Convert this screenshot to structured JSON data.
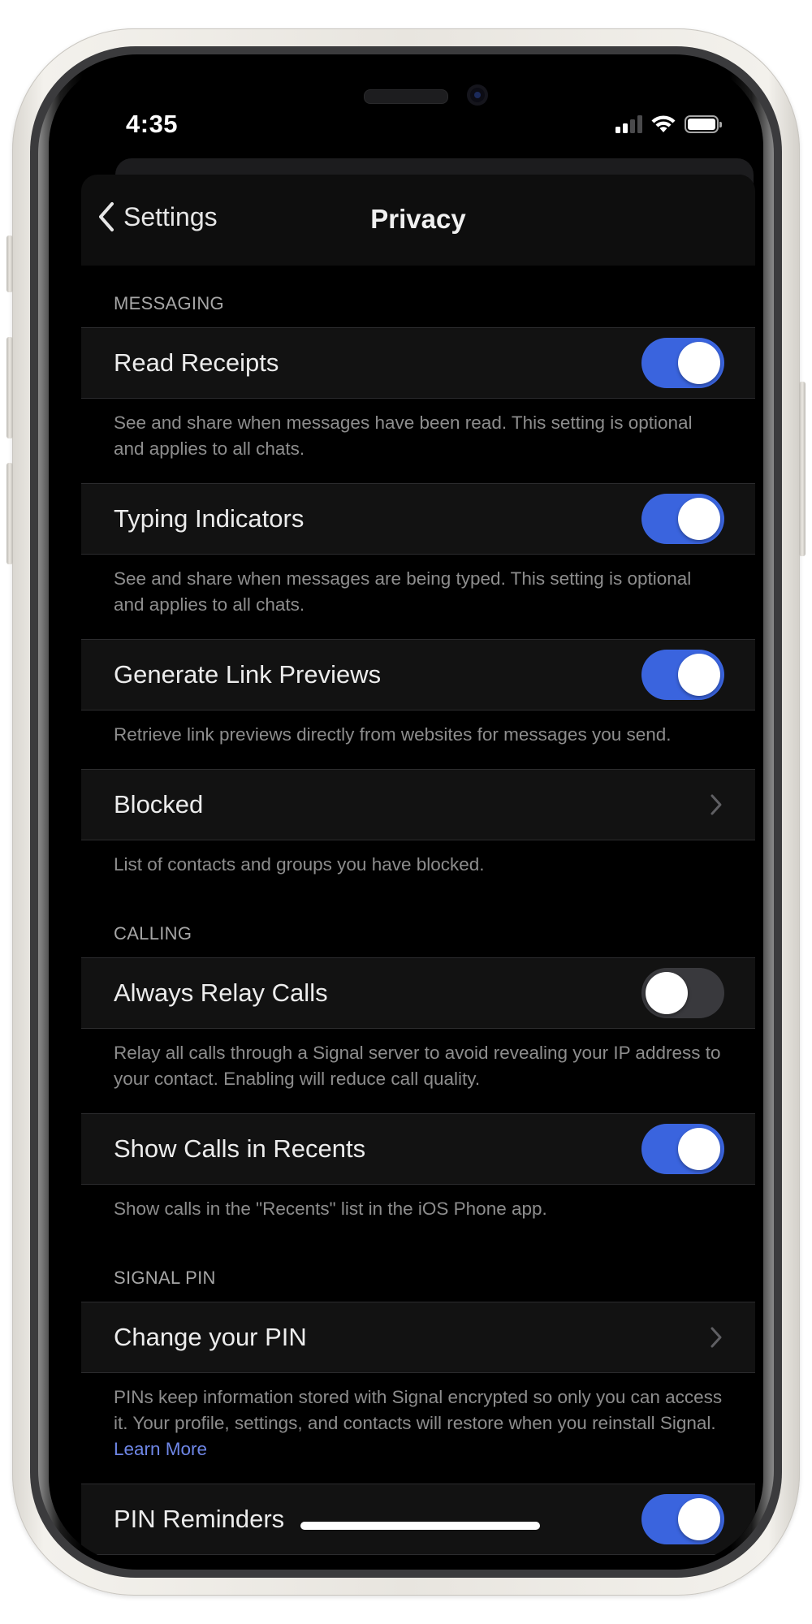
{
  "status_bar": {
    "time": "4:35",
    "signal_bars_active": 2,
    "signal_bars_total": 4,
    "battery_level_percent": 100,
    "icons": [
      "cellular-signal-icon",
      "wifi-icon",
      "battery-icon"
    ]
  },
  "nav": {
    "back_label": "Settings",
    "back_icon": "chevron-left-icon",
    "title": "Privacy"
  },
  "colors": {
    "accent": "#3A64DE",
    "link": "#6E86E6",
    "toggle_off": "#39393D",
    "row_background": "#121212",
    "screen_background": "#000000"
  },
  "sections": {
    "messaging": {
      "header": "MESSAGING",
      "read_receipts": {
        "label": "Read Receipts",
        "enabled": true,
        "footer": "See and share when messages have been read. This setting is optional and applies to all chats."
      },
      "typing_indicators": {
        "label": "Typing Indicators",
        "enabled": true,
        "footer": "See and share when messages are being typed. This setting is optional and applies to all chats."
      },
      "link_previews": {
        "label": "Generate Link Previews",
        "enabled": true,
        "footer": "Retrieve link previews directly from websites for messages you send."
      },
      "blocked": {
        "label": "Blocked",
        "icon": "chevron-right-icon",
        "footer": "List of contacts and groups you have blocked."
      }
    },
    "calling": {
      "header": "CALLING",
      "always_relay": {
        "label": "Always Relay Calls",
        "enabled": false,
        "footer": "Relay all calls through a Signal server to avoid revealing your IP address to your contact. Enabling will reduce call quality."
      },
      "show_in_recents": {
        "label": "Show Calls in Recents",
        "enabled": true,
        "footer": "Show calls in the \"Recents\" list in the iOS Phone app."
      }
    },
    "signal_pin": {
      "header": "SIGNAL PIN",
      "change_pin": {
        "label": "Change your PIN",
        "icon": "chevron-right-icon",
        "footer": "PINs keep information stored with Signal encrypted so only you can access it. Your profile, settings, and contacts will restore when you reinstall Signal.",
        "footer_link": "Learn More"
      },
      "pin_reminders": {
        "label": "PIN Reminders",
        "enabled": true
      }
    }
  }
}
